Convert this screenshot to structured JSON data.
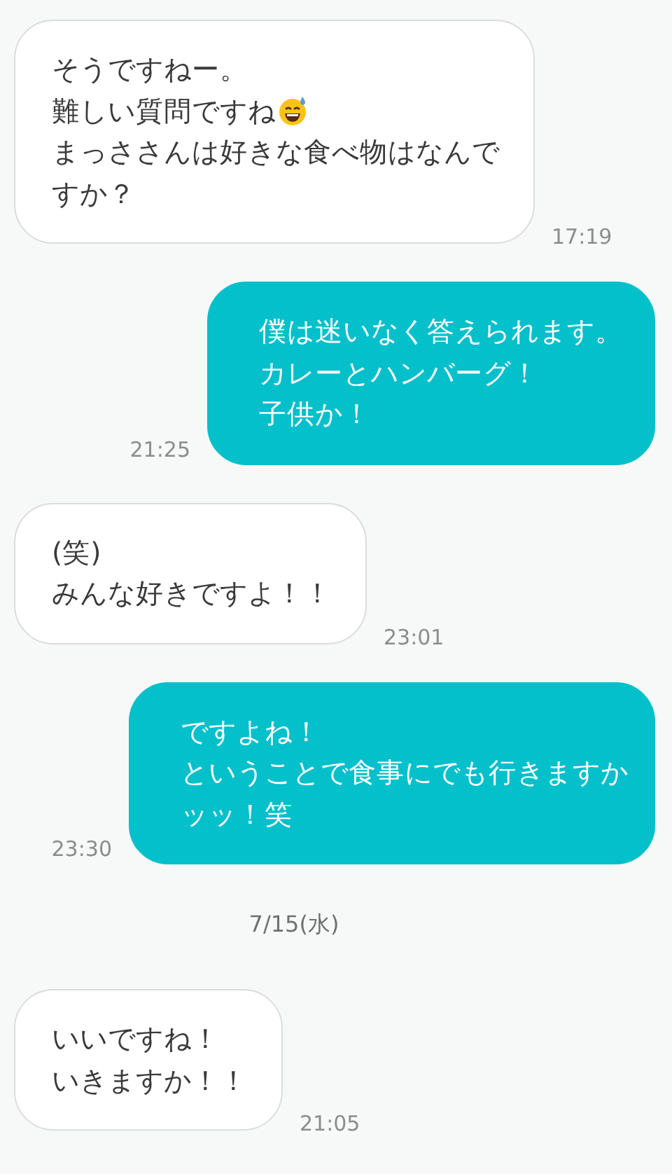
{
  "messages": [
    {
      "kind": "received",
      "lines": [
        {
          "text": "そうですねー。",
          "emoji": false
        },
        {
          "text": "難しい質問ですね",
          "emoji": true
        },
        {
          "text": "まっささんは好きな食べ物はなんで",
          "emoji": false
        },
        {
          "text": "すか？",
          "emoji": false
        }
      ],
      "time": "17:19"
    },
    {
      "kind": "sent",
      "lines": [
        {
          "text": "僕は迷いなく答えられます。",
          "emoji": false
        },
        {
          "text": "カレーとハンバーグ！",
          "emoji": false
        },
        {
          "text": "子供か！",
          "emoji": false
        }
      ],
      "time": "21:25"
    },
    {
      "kind": "received",
      "lines": [
        {
          "text": "(笑)",
          "emoji": false
        },
        {
          "text": "みんな好きですよ！！",
          "emoji": false
        }
      ],
      "time": "23:01"
    },
    {
      "kind": "sent",
      "lines": [
        {
          "text": "ですよね！",
          "emoji": false
        },
        {
          "text": "ということで食事にでも行きますか",
          "emoji": false
        },
        {
          "text": "ッッ！笑",
          "emoji": false
        }
      ],
      "time": "23:30"
    },
    {
      "kind": "date",
      "text": "7/15(水)"
    },
    {
      "kind": "received",
      "lines": [
        {
          "text": "いいですね！",
          "emoji": false
        },
        {
          "text": "いきますか！！",
          "emoji": false
        }
      ],
      "time": "21:05"
    }
  ]
}
